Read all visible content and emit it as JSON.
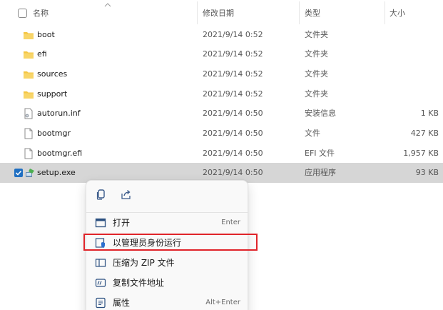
{
  "columns": {
    "name": "名称",
    "date": "修改日期",
    "type": "类型",
    "size": "大小"
  },
  "rows": [
    {
      "icon": "folder-icon",
      "name": "boot",
      "date": "2021/9/14 0:52",
      "type": "文件夹",
      "size": ""
    },
    {
      "icon": "folder-icon",
      "name": "efi",
      "date": "2021/9/14 0:52",
      "type": "文件夹",
      "size": ""
    },
    {
      "icon": "folder-icon",
      "name": "sources",
      "date": "2021/9/14 0:52",
      "type": "文件夹",
      "size": ""
    },
    {
      "icon": "folder-icon",
      "name": "support",
      "date": "2021/9/14 0:52",
      "type": "文件夹",
      "size": ""
    },
    {
      "icon": "setup-info-file-icon",
      "name": "autorun.inf",
      "date": "2021/9/14 0:50",
      "type": "安装信息",
      "size": "1 KB"
    },
    {
      "icon": "file-icon",
      "name": "bootmgr",
      "date": "2021/9/14 0:50",
      "type": "文件",
      "size": "427 KB"
    },
    {
      "icon": "file-icon",
      "name": "bootmgr.efi",
      "date": "2021/9/14 0:50",
      "type": "EFI 文件",
      "size": "1,957 KB"
    },
    {
      "icon": "setup-exe-icon",
      "name": "setup.exe",
      "date": "2021/9/14 0:50",
      "type": "应用程序",
      "size": "93 KB",
      "selected": true
    }
  ],
  "context_menu": {
    "quick_actions": [
      "copy-icon",
      "share-icon"
    ],
    "items": [
      {
        "icon": "open-icon",
        "label": "打开",
        "shortcut": "Enter"
      },
      {
        "icon": "shield-icon",
        "label": "以管理员身份运行",
        "shortcut": ""
      },
      {
        "icon": "zip-icon",
        "label": "压缩为 ZIP 文件",
        "shortcut": ""
      },
      {
        "icon": "copy-path-icon",
        "label": "复制文件地址",
        "shortcut": ""
      },
      {
        "icon": "properties-icon",
        "label": "属性",
        "shortcut": "Alt+Enter"
      }
    ]
  },
  "colors": {
    "selection": "#d6d6d6",
    "highlight_box": "#e0242a",
    "folder": "#f4c542",
    "checkbox": "#1f6fc2"
  }
}
